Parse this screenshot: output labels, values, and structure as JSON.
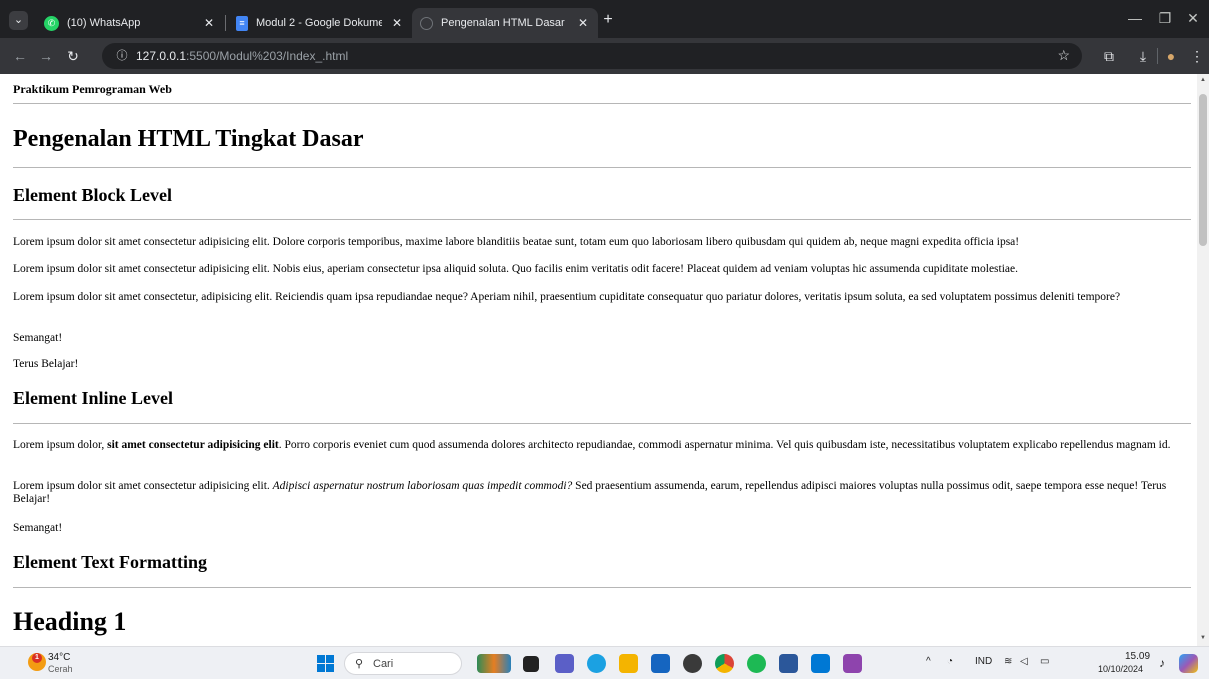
{
  "browser": {
    "tabs": [
      {
        "title": "(10) WhatsApp",
        "icon": "whatsapp-icon",
        "active": false
      },
      {
        "title": "Modul 2 - Google Dokumen",
        "icon": "google-docs-icon",
        "active": false
      },
      {
        "title": "Pengenalan HTML Dasar",
        "icon": "globe-icon",
        "active": true
      }
    ],
    "url_host": "127.0.0.1",
    "url_path": ":5500/Modul%203/Index_.html"
  },
  "page": {
    "site_title": "Praktikum Pemrograman Web",
    "main_heading": "Pengenalan HTML Tingkat Dasar",
    "block": {
      "heading": "Element Block Level",
      "paragraphs": [
        "Lorem ipsum dolor sit amet consectetur adipisicing elit. Dolore corporis temporibus, maxime labore blanditiis beatae sunt, totam eum quo laboriosam libero quibusdam qui quidem ab, neque magni expedita officia ipsa!",
        "Lorem ipsum dolor sit amet consectetur adipisicing elit. Nobis eius, aperiam consectetur ipsa aliquid soluta. Quo facilis enim veritatis odit facere! Placeat quidem ad veniam voluptas hic assumenda cupiditate molestiae.",
        "Lorem ipsum dolor sit amet consectetur, adipisicing elit. Reiciendis quam ipsa repudiandae neque? Aperiam nihil, praesentium cupiditate consequatur quo pariatur dolores, veritatis ipsum soluta, ea sed voluptatem possimus deleniti tempore?",
        "Semangat!",
        "Terus Belajar!"
      ]
    },
    "inline": {
      "heading": "Element Inline Level",
      "p1": {
        "before": "Lorem ipsum dolor, ",
        "bold": "sit amet consectetur adipisicing elit",
        "after": ". Porro corporis eveniet cum quod assumenda dolores architecto repudiandae, commodi aspernatur minima. Vel quis quibusdam iste, necessitatibus voluptatem explicabo repellendus magnam id."
      },
      "p2": {
        "before": "Lorem ipsum dolor sit amet consectetur adipisicing elit. ",
        "italic": "Adipisci aspernatur nostrum laboriosam quas impedit commodi?",
        "after": " Sed praesentium assumenda, earum, repellendus adipisci maiores voluptas nulla possimus odit, saepe tempora esse neque! Terus Belajar!"
      },
      "p3": "Semangat!"
    },
    "formatting": {
      "heading": "Element Text Formatting",
      "heading1": "Heading 1"
    }
  },
  "taskbar": {
    "weather_temp": "34°C",
    "weather_condition": "Cerah",
    "weather_badge": "1",
    "search_placeholder": "Cari",
    "language": "IND",
    "time": "15.09",
    "date": "10/10/2024"
  },
  "colors": {
    "chrome_dark": "#202124",
    "chrome_toolbar": "#35363a",
    "whatsapp": "#25d366",
    "google_docs": "#4285f4",
    "windows_blue": "#0078d4"
  }
}
